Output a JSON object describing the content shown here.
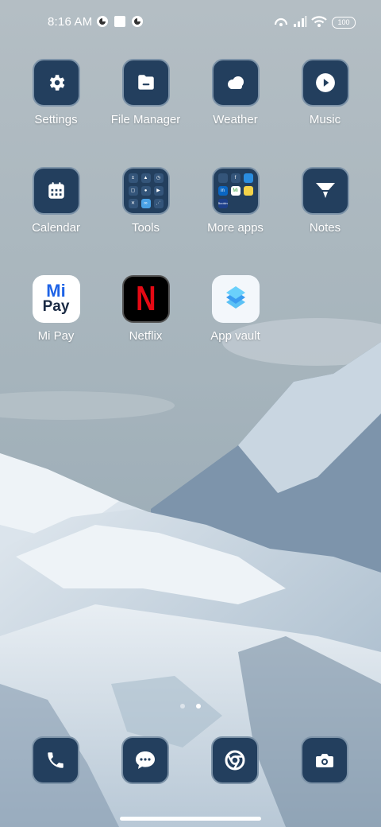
{
  "status_bar": {
    "time": "8:16 AM",
    "battery": "100",
    "left_icons": [
      "data-saver-icon",
      "square-notification-icon",
      "data-saver-icon"
    ],
    "right_icons": [
      "hotspot-icon",
      "cellular-signal-icon",
      "wifi-icon",
      "battery-icon"
    ]
  },
  "apps": [
    {
      "label": "Settings",
      "icon": "gear-icon"
    },
    {
      "label": "File Manager",
      "icon": "folder-icon"
    },
    {
      "label": "Weather",
      "icon": "cloud-icon"
    },
    {
      "label": "Music",
      "icon": "play-icon"
    },
    {
      "label": "Calendar",
      "icon": "calendar-icon"
    },
    {
      "label": "Tools",
      "icon": "folder-grid-icon"
    },
    {
      "label": "More apps",
      "icon": "folder-grid-icon"
    },
    {
      "label": "Notes",
      "icon": "notes-icon"
    },
    {
      "label": "Mi Pay",
      "icon": "mi-pay-logo",
      "logo_text_top": "Mi",
      "logo_text_bottom": "Pay"
    },
    {
      "label": "Netflix",
      "icon": "netflix-logo",
      "logo_text": "N"
    },
    {
      "label": "App vault",
      "icon": "app-vault-icon"
    }
  ],
  "tools_folder_icons": [
    "calculator-icon",
    "compass-icon",
    "clock-icon",
    "scanner-icon",
    "recorder-icon",
    "screen-recorder-icon",
    "cleaner-icon",
    "mi-remote-icon",
    "other-icon"
  ],
  "more_apps_folder": {
    "mini_labels": [
      "",
      "f",
      "",
      "in",
      "Mi",
      "",
      "Booking"
    ],
    "icons": [
      "shopping-icon",
      "facebook-icon",
      "app-icon",
      "linkedin-icon",
      "mi-icon",
      "app-icon",
      "booking-icon"
    ]
  },
  "page_indicator": {
    "pages": 2,
    "current": 2
  },
  "dock": [
    {
      "icon": "phone-icon"
    },
    {
      "icon": "messages-icon"
    },
    {
      "icon": "chrome-icon"
    },
    {
      "icon": "camera-icon"
    }
  ],
  "colors": {
    "tile_bg": "#233f5e",
    "tile_border": "#7d93a8",
    "netflix_red": "#e50914",
    "mi_pay_blue": "#1e63e6"
  }
}
